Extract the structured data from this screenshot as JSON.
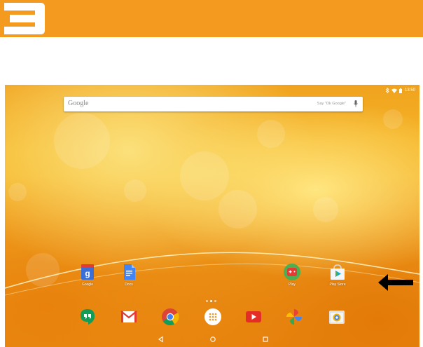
{
  "banner": {
    "step_number": "3",
    "color": "#f39a1f"
  },
  "status_bar": {
    "time": "13:50"
  },
  "search": {
    "logo_text": "Google",
    "hint": "Say \"Ok Google\""
  },
  "desktop_apps": [
    {
      "label": "Google",
      "icon": "google-icon"
    },
    {
      "label": "Docs",
      "icon": "docs-icon"
    },
    {
      "label": "Play",
      "icon": "play-games-icon"
    },
    {
      "label": "Play Store",
      "icon": "play-store-icon"
    }
  ],
  "dock_apps": [
    {
      "name": "Hangouts",
      "icon": "hangouts-icon"
    },
    {
      "name": "Gmail",
      "icon": "gmail-icon"
    },
    {
      "name": "Chrome",
      "icon": "chrome-icon"
    },
    {
      "name": "All apps",
      "icon": "all-apps-icon"
    },
    {
      "name": "YouTube",
      "icon": "youtube-icon"
    },
    {
      "name": "Photos",
      "icon": "photos-icon"
    },
    {
      "name": "Camera",
      "icon": "camera-icon"
    }
  ],
  "navigation": [
    "back-icon",
    "home-icon",
    "recents-icon"
  ],
  "annotation": {
    "target": "Play Store",
    "icon": "arrow-left-icon"
  }
}
